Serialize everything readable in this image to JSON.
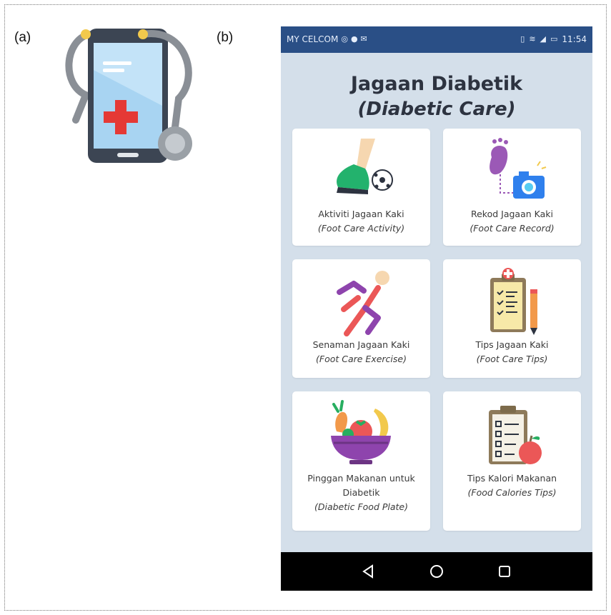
{
  "figure": {
    "label_a": "(a)",
    "label_b": "(b)"
  },
  "status_bar": {
    "carrier": "MY CELCOM",
    "time": "11:54"
  },
  "header": {
    "title": "Jagaan Diabetik",
    "subtitle": "(Diabetic Care)"
  },
  "cards": [
    {
      "title": "Aktiviti Jagaan Kaki",
      "title_line2": "",
      "subtitle": "(Foot Care Activity)",
      "icon": "soccer-kick-icon"
    },
    {
      "title": "Rekod Jagaan Kaki",
      "title_line2": "",
      "subtitle": "(Foot Care Record)",
      "icon": "footprint-camera-icon"
    },
    {
      "title": "Senaman Jagaan Kaki",
      "title_line2": "",
      "subtitle": "(Foot Care Exercise)",
      "icon": "running-person-icon"
    },
    {
      "title": "Tips Jagaan Kaki",
      "title_line2": "",
      "subtitle": "(Foot Care Tips)",
      "icon": "medical-clipboard-icon"
    },
    {
      "title": "Pinggan Makanan untuk",
      "title_line2": "Diabetik",
      "subtitle": "(Diabetic Food Plate)",
      "icon": "fruit-bowl-icon"
    },
    {
      "title": "Tips Kalori Makanan",
      "title_line2": "",
      "subtitle": "(Food Calories Tips)",
      "icon": "checklist-apple-icon"
    }
  ],
  "nav": {
    "back_icon": "back-triangle-icon",
    "home_icon": "home-circle-icon",
    "recents_icon": "recents-square-icon"
  },
  "colors": {
    "status_bar": "#2a4f86",
    "screen_background": "#d4dfea",
    "card_background": "#ffffff",
    "nav_bar": "#000000"
  }
}
